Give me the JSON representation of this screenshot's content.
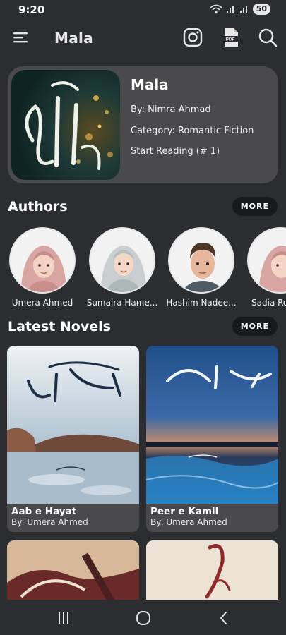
{
  "status_bar": {
    "time": "9:20",
    "battery": "50"
  },
  "app_bar": {
    "title": "Mala"
  },
  "featured": {
    "title": "Mala",
    "author_line": "By: Nimra Ahmad",
    "category_line": "Category: Romantic Fiction",
    "reading_line": "Start Reading (# 1)"
  },
  "authors_section": {
    "title": "Authors",
    "more_label": "MORE",
    "items": [
      {
        "name": "Umera Ahmed"
      },
      {
        "name": "Sumaira Hame..."
      },
      {
        "name": "Hashim Nadee..."
      },
      {
        "name": "Sadia Ro"
      }
    ]
  },
  "novels_section": {
    "title": "Latest Novels",
    "more_label": "MORE",
    "items": [
      {
        "title": "Aab e Hayat",
        "author": "By: Umera Ahmed"
      },
      {
        "title": "Peer e Kamil",
        "author": "By: Umera Ahmed"
      }
    ]
  },
  "colors": {
    "background": "#2b2d31",
    "card": "#4a4a4d",
    "button": "#17191b"
  },
  "icons": [
    "menu-icon",
    "instagram-icon",
    "pdf-icon",
    "search-icon",
    "recents-icon",
    "home-icon",
    "back-icon"
  ]
}
